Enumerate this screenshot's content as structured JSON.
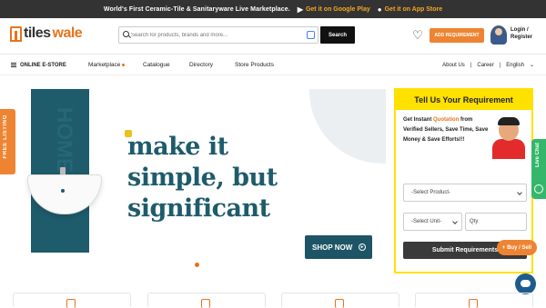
{
  "topbar": {
    "message": "World's First Ceramic-Tile & Sanitaryware Live Marketplace.",
    "google_play": "Get it on Google Play",
    "app_store": "Get it on App Store"
  },
  "header": {
    "logo_part1": "tiles",
    "logo_part2": "wale",
    "search_placeholder": "Search for products, brands and more...",
    "search_button": "Search",
    "add_requirement": "ADD REQUIREMENT",
    "login_line1": "Login /",
    "login_line2": "Register"
  },
  "nav": {
    "estore": "ONLINE E-STORE",
    "items": [
      "Marketplace",
      "Catalogue",
      "Directory",
      "Store Products"
    ],
    "about": "About Us",
    "career": "Career",
    "language": "English"
  },
  "hero": {
    "headline_line1": "make it",
    "headline_line2": "simple, but",
    "headline_line3": "significant",
    "shop_now": "SHOP NOW",
    "side_text": "HOME"
  },
  "free_listing": "FREE LISTING",
  "requirement": {
    "title": "Tell Us Your Requirement",
    "desc_pre": "Get Instant ",
    "desc_highlight": "Quotation",
    "desc_post": " from Verified Sellers, Save Time, Save Money & Save Efforts!!!",
    "select_product": "-Select Product-",
    "select_unit": "-Select Unit-",
    "qty_placeholder": "Qty",
    "submit": "Submit Requirements"
  },
  "buy_sell": "+ Buy / Sell",
  "live_chat": "Live Chat",
  "colors": {
    "accent": "#ee8432",
    "teal": "#1e5b6b",
    "yellow": "#ffe100",
    "topbar": "#333333"
  }
}
